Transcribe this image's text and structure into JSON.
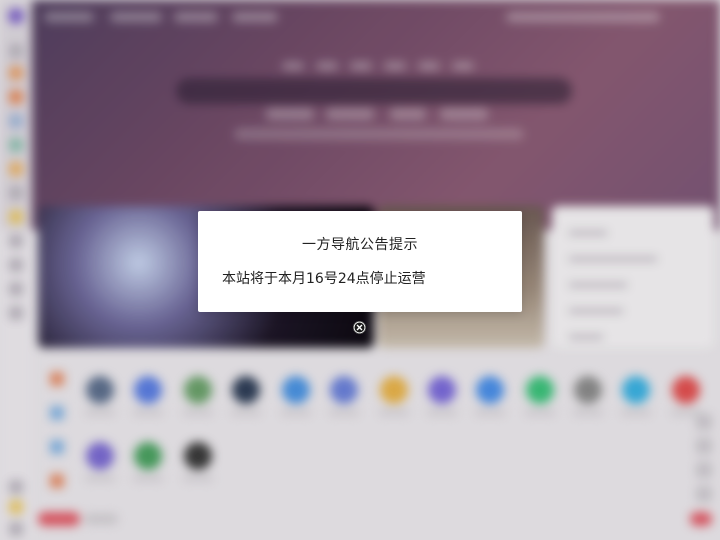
{
  "notice": {
    "title": "一方导航公告提示",
    "message": "本站将于本月16号24点停止运营"
  },
  "icons": {
    "close": "close-circle-icon"
  },
  "colors": {
    "hero_start": "#4f3f60",
    "hero_end": "#8a5b74",
    "accent_red": "#e05a66",
    "modal_bg": "#ffffff"
  }
}
